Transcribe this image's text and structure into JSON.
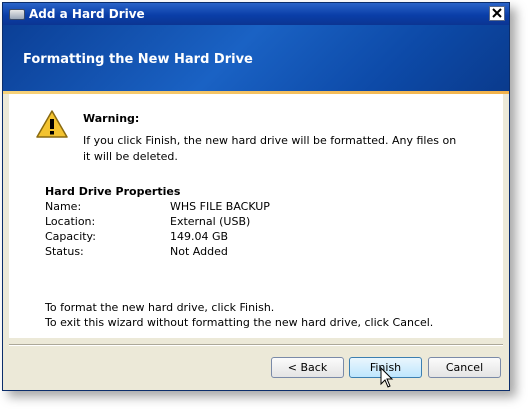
{
  "window": {
    "title": "Add a Hard Drive",
    "icon": "hard-drive-icon",
    "close_icon": "close-icon"
  },
  "banner": {
    "title": "Formatting the New Hard Drive"
  },
  "warning": {
    "icon": "warning-icon",
    "title": "Warning:",
    "text": "If you click Finish, the new hard drive will be formatted.  Any files on it will be deleted."
  },
  "properties": {
    "title": "Hard Drive Properties",
    "rows": [
      {
        "label": "Name:",
        "value": "WHS FILE BACKUP"
      },
      {
        "label": "Location:",
        "value": "External (USB)"
      },
      {
        "label": "Capacity:",
        "value": "149.04 GB"
      },
      {
        "label": "Status:",
        "value": "Not Added"
      }
    ]
  },
  "instructions": {
    "line1": "To format the new hard drive, click Finish.",
    "line2": "To exit this wizard without formatting the new hard drive, click Cancel."
  },
  "buttons": {
    "back": "< Back",
    "finish": "Finish",
    "cancel": "Cancel"
  },
  "colors": {
    "banner": "#1a56b8",
    "accent_line": "#f2b24a"
  }
}
